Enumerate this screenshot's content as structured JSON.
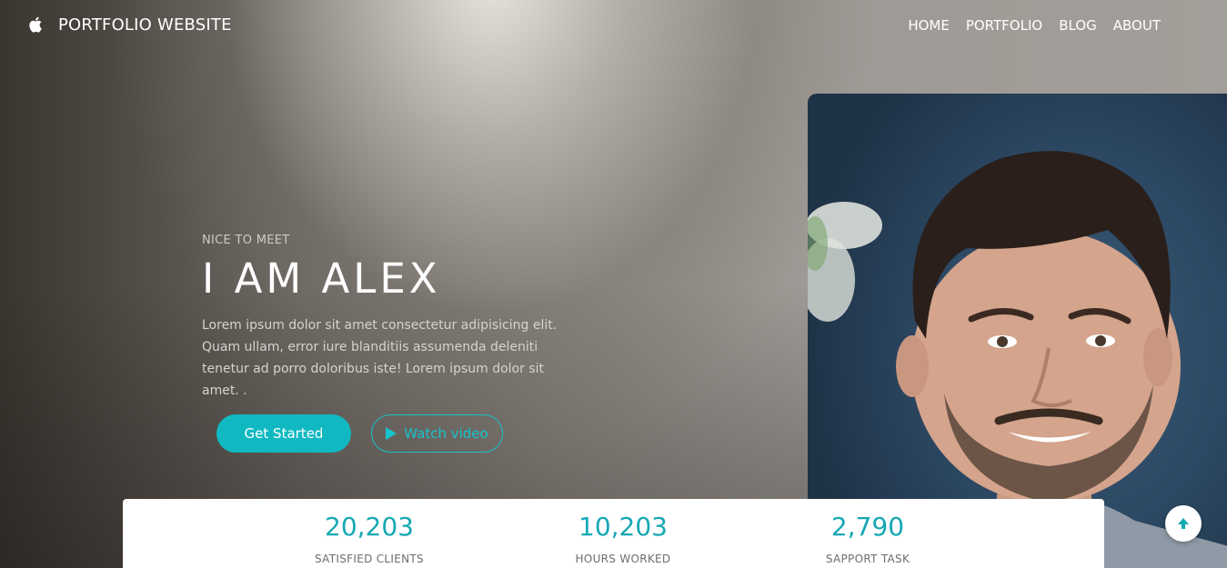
{
  "header": {
    "brand": "PORTFOLIO WEBSITE",
    "brand_icon": "apple-icon",
    "nav": [
      {
        "label": "HOME"
      },
      {
        "label": "PORTFOLIO"
      },
      {
        "label": "BLOG"
      },
      {
        "label": "ABOUT"
      }
    ]
  },
  "hero": {
    "eyebrow": "NICE TO MEET",
    "headline": "I AM ALEX",
    "description": "Lorem ipsum dolor sit amet consectetur adipisicing elit. Quam ullam, error iure blanditiis assumenda deleniti tenetur ad porro doloribus iste! Lorem ipsum dolor sit amet. .",
    "primary_button": "Get Started",
    "secondary_button": "Watch video",
    "secondary_icon": "play-icon"
  },
  "stats": [
    {
      "value": "20,203",
      "label": "SATISFIED CLIENTS"
    },
    {
      "value": "10,203",
      "label": "HOURS WORKED"
    },
    {
      "value": "2,790",
      "label": "SAPPORT TASK"
    }
  ],
  "colors": {
    "accent": "#10b9c1",
    "stat_number": "#16a8b4"
  },
  "scroll_top_icon": "arrow-up-icon"
}
